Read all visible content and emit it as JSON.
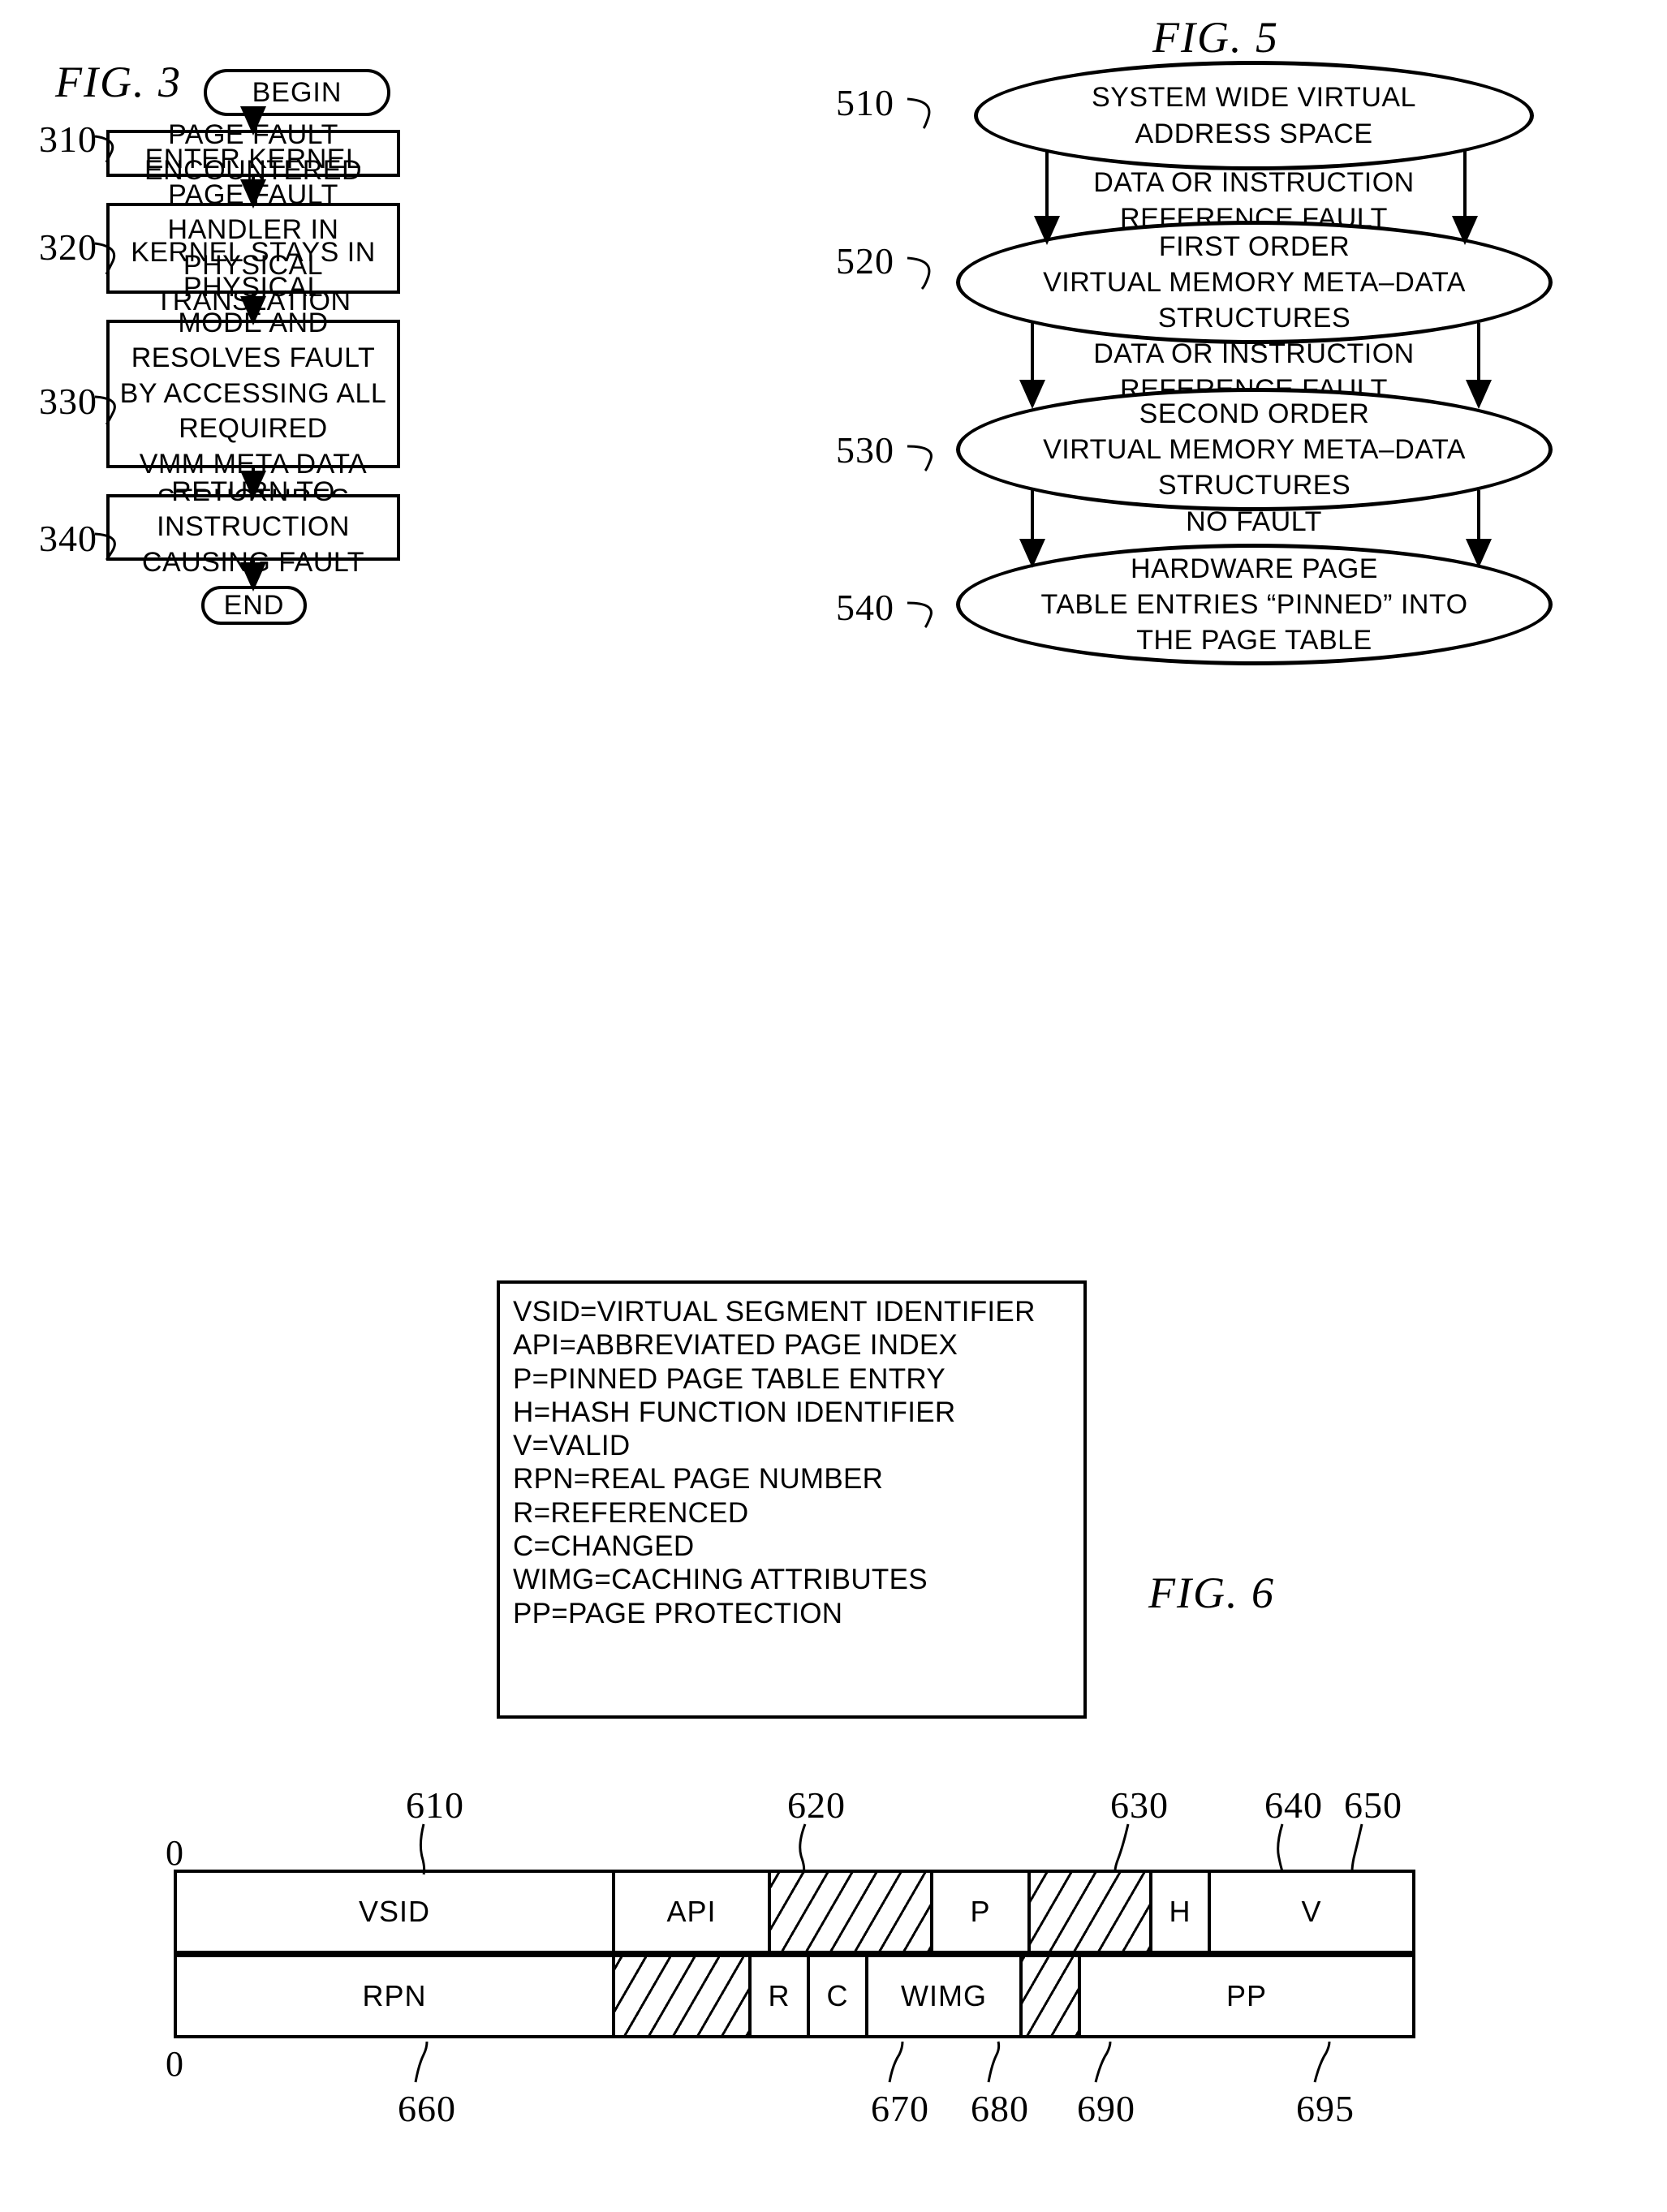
{
  "figures": {
    "fig3": {
      "title": "FIG. 3",
      "start_label": "BEGIN",
      "end_label": "END",
      "steps": [
        {
          "ref": "310",
          "text": "PAGE FAULT ENCOUNTERED"
        },
        {
          "ref": "320",
          "text": "ENTER KERNEL PAGE FAULT\nHANDLER IN PHYSICAL\nTRANSLATION MODE"
        },
        {
          "ref": "330",
          "text": "KERNEL STAYS IN PHYSICAL\nMODE AND RESOLVES FAULT\nBY ACCESSING ALL REQUIRED\nVMM META DATA STRUCTURES\nIN PHYSICAL MODE"
        },
        {
          "ref": "340",
          "text": "RETURN TO INSTRUCTION\nCAUSING FAULT"
        }
      ]
    },
    "fig5": {
      "title": "FIG. 5",
      "nodes": [
        {
          "ref": "510",
          "text": "SYSTEM WIDE VIRTUAL\nADDRESS SPACE"
        },
        {
          "ref": "520",
          "text": "FIRST ORDER\nVIRTUAL MEMORY META–DATA\nSTRUCTURES"
        },
        {
          "ref": "530",
          "text": "SECOND ORDER\nVIRTUAL MEMORY META–DATA\nSTRUCTURES"
        },
        {
          "ref": "540",
          "text": "HARDWARE PAGE\nTABLE ENTRIES “PINNED” INTO\nTHE PAGE TABLE"
        }
      ],
      "edges": [
        {
          "text": "DATA OR INSTRUCTION\nREFERENCE FAULT"
        },
        {
          "text": "DATA OR INSTRUCTION\nREFERENCE FAULT"
        },
        {
          "text": "NO FAULT"
        }
      ]
    },
    "fig6": {
      "title": "FIG. 6",
      "legend": [
        "VSID=VIRTUAL SEGMENT IDENTIFIER",
        "API=ABBREVIATED PAGE INDEX",
        "P=PINNED PAGE TABLE ENTRY",
        "H=HASH FUNCTION IDENTIFIER",
        "V=VALID",
        "RPN=REAL PAGE NUMBER",
        "R=REFERENCED",
        "C=CHANGED",
        "WIMG=CACHING ATTRIBUTES",
        "PP=PAGE PROTECTION"
      ],
      "zero_label_top": "0",
      "zero_label_bottom": "0",
      "top_refs": [
        "610",
        "620",
        "630",
        "640",
        "650"
      ],
      "bottom_refs": [
        "660",
        "670",
        "680",
        "690",
        "695"
      ],
      "row_top": {
        "cells": [
          {
            "label": "VSID",
            "hatched": false
          },
          {
            "label": "API",
            "hatched": false
          },
          {
            "label": "",
            "hatched": true
          },
          {
            "label": "P",
            "hatched": false
          },
          {
            "label": "",
            "hatched": true
          },
          {
            "label": "H",
            "hatched": false
          },
          {
            "label": "V",
            "hatched": false
          }
        ]
      },
      "row_bottom": {
        "cells": [
          {
            "label": "RPN",
            "hatched": false
          },
          {
            "label": "",
            "hatched": true
          },
          {
            "label": "R",
            "hatched": false
          },
          {
            "label": "C",
            "hatched": false
          },
          {
            "label": "WIMG",
            "hatched": false
          },
          {
            "label": "",
            "hatched": true
          },
          {
            "label": "PP",
            "hatched": false
          }
        ]
      }
    }
  }
}
